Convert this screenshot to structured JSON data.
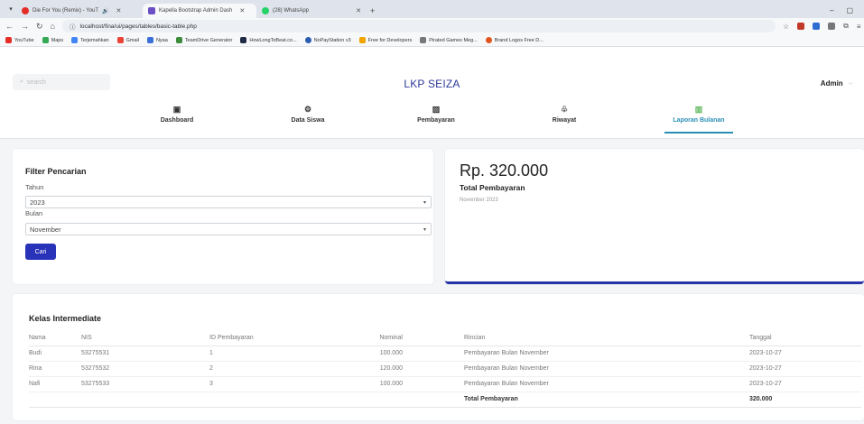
{
  "browser": {
    "tabs": [
      {
        "label": "Die For You (Remix) - YouT",
        "icon": "youtube-icon",
        "color": "#e52d27"
      },
      {
        "label": "Kapella Bootstrap Admin Dash",
        "icon": "kapella-icon",
        "color": "#6a4fc4"
      },
      {
        "label": "(28) WhatsApp",
        "icon": "whatsapp-icon",
        "color": "#25d366"
      }
    ],
    "url": "localhost/fina/ui/pages/tables/basic-table.php",
    "bookmarks": [
      {
        "label": "YouTube",
        "color": "#e52d27"
      },
      {
        "label": "Maps",
        "color": "#34a853"
      },
      {
        "label": "Terjemahkan",
        "color": "#4285f4"
      },
      {
        "label": "Gmail",
        "color": "#ea4335"
      },
      {
        "label": "Nyaa",
        "color": "#3a6fd8"
      },
      {
        "label": "TeamDrive Generator",
        "color": "#3b8c3b"
      },
      {
        "label": "HowLongToBeat.co...",
        "color": "#1f2a44"
      },
      {
        "label": "NoPayStation v3",
        "color": "#2a5db0"
      },
      {
        "label": "Free for Developers",
        "color": "#f0a500"
      },
      {
        "label": "Pirated Games Meg...",
        "color": "#777777"
      },
      {
        "label": "Brand Logos Free D...",
        "color": "#e0541f"
      }
    ]
  },
  "header": {
    "search_placeholder": "search",
    "brand": "LKP SEIZA",
    "user": "Admin"
  },
  "nav": [
    {
      "label": "Dashboard",
      "icon": "dashboard-icon",
      "glyph": "▣"
    },
    {
      "label": "Data Siswa",
      "icon": "student-data-icon",
      "glyph": "⚙"
    },
    {
      "label": "Pembayaran",
      "icon": "payment-icon",
      "glyph": "▨"
    },
    {
      "label": "Riwayat",
      "icon": "history-icon",
      "glyph": "♧"
    },
    {
      "label": "Laporan Bulanan",
      "icon": "monthly-report-icon",
      "glyph": "▥"
    }
  ],
  "filter": {
    "title": "Filter Pencarian",
    "year_label": "Tahun",
    "year_value": "2023",
    "month_label": "Bulan",
    "month_value": "November",
    "search_button": "Cari"
  },
  "summary": {
    "amount": "Rp. 320.000",
    "label": "Total Pembayaran",
    "period": "November 2023"
  },
  "table": {
    "title": "Kelas Intermediate",
    "columns": [
      "Nama",
      "NIS",
      "ID Pembayaran",
      "Nominal",
      "Rincian",
      "Tanggal"
    ],
    "rows": [
      [
        "Budi",
        "53275531",
        "1",
        "100.000",
        "Pembayaran Bulan November",
        "2023-10-27"
      ],
      [
        "Rina",
        "53275532",
        "2",
        "120.000",
        "Pembayaran Bulan November",
        "2023-10-27"
      ],
      [
        "Nafi",
        "53275533",
        "3",
        "100.000",
        "Pembayaran Bulan November",
        "2023-10-27"
      ]
    ],
    "total_label": "Total Pembayaran",
    "total_value": "320.000"
  }
}
